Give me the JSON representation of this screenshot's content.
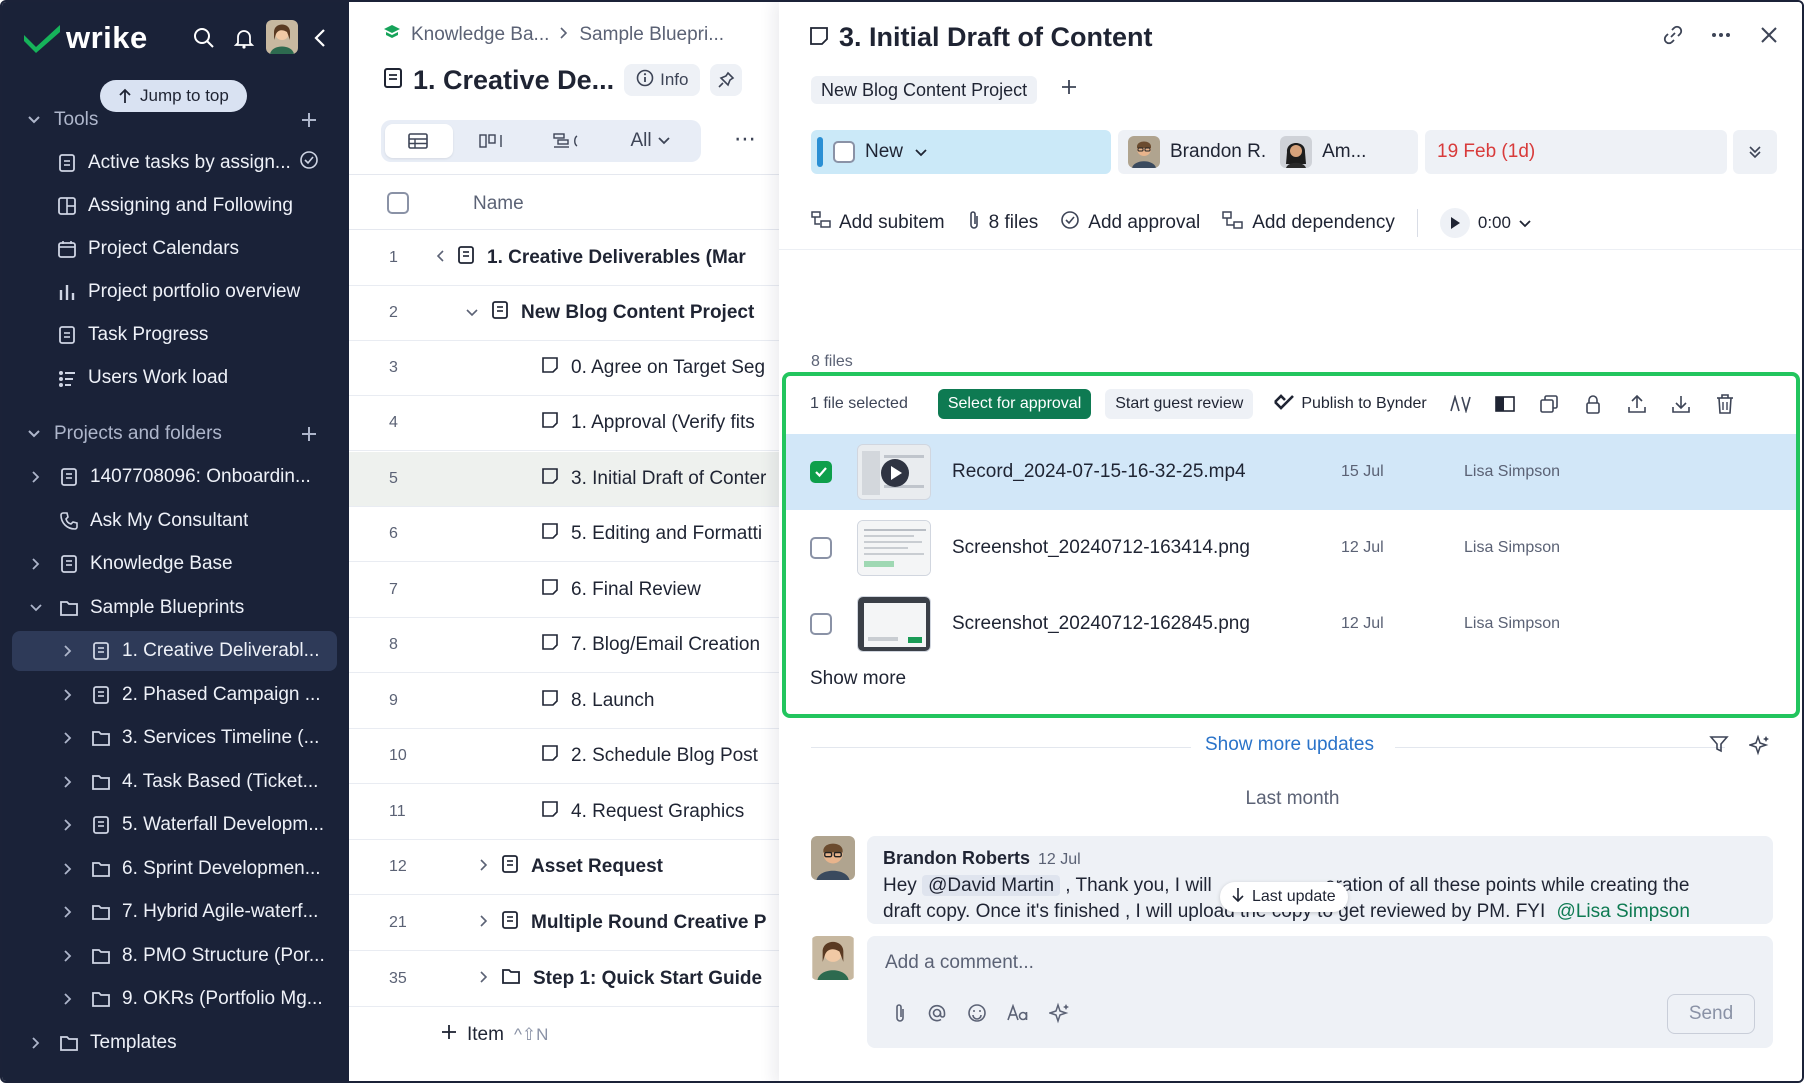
{
  "app": {
    "logo": "wrike"
  },
  "sidebar": {
    "jump_to_top": "Jump to top",
    "tools_header": "Tools",
    "tools": [
      {
        "label": "Active tasks by assign..."
      },
      {
        "label": "Assigning and Following"
      },
      {
        "label": "Project Calendars"
      },
      {
        "label": "Project portfolio overview"
      },
      {
        "label": "Task Progress"
      },
      {
        "label": "Users Work load"
      }
    ],
    "projects_header": "Projects and folders",
    "projects": [
      {
        "label": "1407708096: Onboardin..."
      },
      {
        "label": "Ask My Consultant"
      },
      {
        "label": "Knowledge Base"
      },
      {
        "label": "Sample Blueprints"
      },
      {
        "label": "1. Creative Deliverabl..."
      },
      {
        "label": "2. Phased Campaign ..."
      },
      {
        "label": "3. Services Timeline (..."
      },
      {
        "label": "4. Task Based (Ticket..."
      },
      {
        "label": "5. Waterfall Developm..."
      },
      {
        "label": "6. Sprint Developmen..."
      },
      {
        "label": "7. Hybrid Agile-waterf..."
      },
      {
        "label": "8. PMO Structure (Por..."
      },
      {
        "label": "9. OKRs (Portfolio Mg..."
      },
      {
        "label": "Templates"
      }
    ]
  },
  "list": {
    "breadcrumb": [
      "Knowledge Ba...",
      "Sample Bluepri..."
    ],
    "title": "1. Creative De...",
    "info_label": "Info",
    "filter_all": "All",
    "col_name": "Name",
    "rows": [
      {
        "num": "1",
        "label": "1. Creative Deliverables (Mar"
      },
      {
        "num": "2",
        "label": "New Blog Content Project"
      },
      {
        "num": "3",
        "label": "0. Agree on Target Seg"
      },
      {
        "num": "4",
        "label": "1. Approval (Verify fits"
      },
      {
        "num": "5",
        "label": "3. Initial Draft of Conter"
      },
      {
        "num": "6",
        "label": "5. Editing and Formatti"
      },
      {
        "num": "7",
        "label": "6. Final Review"
      },
      {
        "num": "8",
        "label": "7. Blog/Email Creation"
      },
      {
        "num": "9",
        "label": "8. Launch"
      },
      {
        "num": "10",
        "label": "2. Schedule Blog Post"
      },
      {
        "num": "11",
        "label": "4. Request Graphics"
      },
      {
        "num": "12",
        "label": "Asset Request"
      },
      {
        "num": "21",
        "label": "Multiple Round Creative P"
      },
      {
        "num": "35",
        "label": "Step 1: Quick Start Guide"
      }
    ],
    "add_item": "Item",
    "add_item_hint": "^⇧N"
  },
  "task": {
    "title": "3. Initial Draft of Content",
    "tag": "New Blog Content Project",
    "status": "New",
    "assignee1": "Brandon R.",
    "assignee2": "Am...",
    "due": "19 Feb (1d)",
    "actions": {
      "add_subitem": "Add subitem",
      "files": "8 files",
      "add_approval": "Add approval",
      "add_dependency": "Add dependency",
      "timer": "0:00"
    },
    "files_label": "8 files",
    "files_toolbar": {
      "selected": "1 file selected",
      "select_approval": "Select for approval",
      "guest_review": "Start guest review",
      "publish": "Publish to Bynder"
    },
    "files": [
      {
        "name": "Record_2024-07-15-16-32-25.mp4",
        "date": "15 Jul",
        "author": "Lisa Simpson"
      },
      {
        "name": "Screenshot_20240712-163414.png",
        "date": "12 Jul",
        "author": "Lisa Simpson"
      },
      {
        "name": "Screenshot_20240712-162845.png",
        "date": "12 Jul",
        "author": "Lisa Simpson"
      }
    ],
    "show_more": "Show more",
    "show_more_updates": "Show more updates",
    "last_month": "Last month",
    "comment": {
      "author": "Brandon Roberts",
      "date": "12 Jul",
      "t1": "Hey",
      "m1": "@David Martin",
      "t2": ", Thank you, I will ",
      "t3": "eration of all these points while creating the",
      "t4": "draft copy. Once it's finished , I will upload the copy to get reviewed by PM. FYI",
      "m2": "@Lisa Simpson"
    },
    "last_update": "Last update",
    "compose_placeholder": "Add a comment...",
    "send": "Send"
  }
}
